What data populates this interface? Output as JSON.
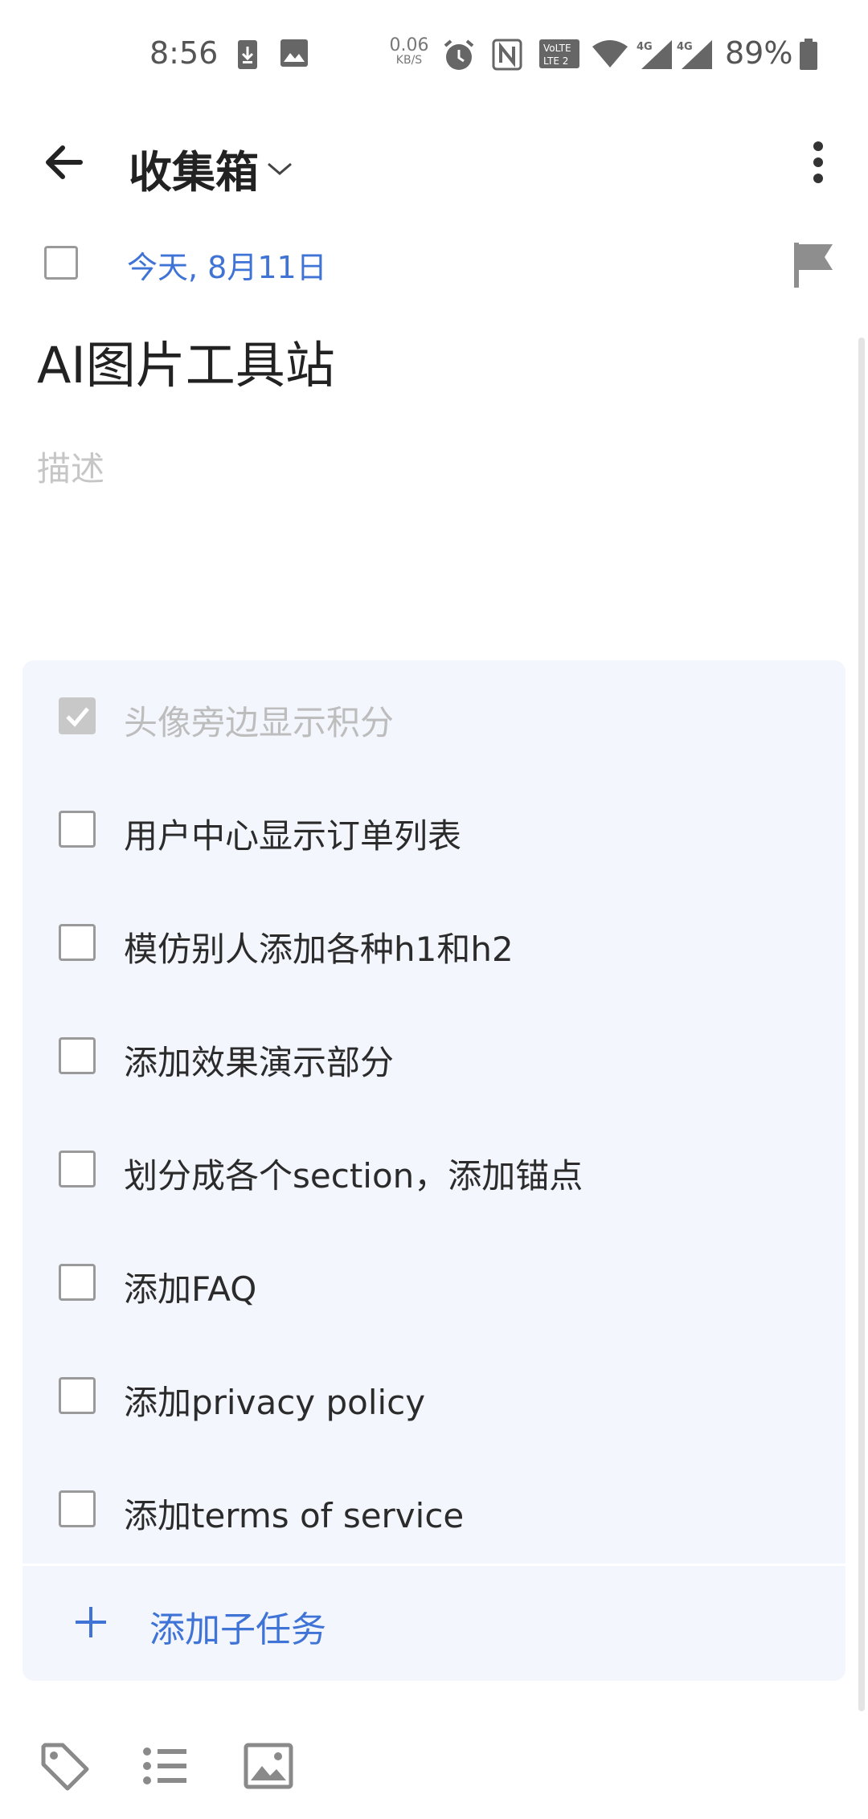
{
  "status_bar": {
    "time": "8:56",
    "net_speed_value": "0.06",
    "net_speed_unit": "KB/S",
    "battery": "89%",
    "icons": [
      "download-icon",
      "image-icon",
      "alarm-icon",
      "nfc-icon",
      "volte-icon",
      "wifi-icon",
      "signal-4g-icon",
      "signal-4g-icon",
      "battery-icon"
    ]
  },
  "header": {
    "title": "收集箱",
    "back_icon": "arrow-left-icon",
    "more_icon": "more-vertical-icon"
  },
  "task": {
    "date": "今天, 8月11日",
    "title": "AI图片工具站",
    "description_placeholder": "描述"
  },
  "subtasks": [
    {
      "label": "头像旁边显示积分",
      "done": true
    },
    {
      "label": "用户中心显示订单列表",
      "done": false
    },
    {
      "label": "模仿别人添加各种h1和h2",
      "done": false
    },
    {
      "label": "添加效果演示部分",
      "done": false
    },
    {
      "label": "划分成各个section，添加锚点",
      "done": false
    },
    {
      "label": "添加FAQ",
      "done": false
    },
    {
      "label": "添加privacy policy",
      "done": false
    },
    {
      "label": "添加terms of service",
      "done": false
    }
  ],
  "add_subtask_label": "添加子任务",
  "toolbar": {
    "icons": [
      "tag-icon",
      "checklist-icon",
      "image-icon"
    ]
  },
  "colors": {
    "accent": "#3f73d6",
    "panel_bg": "#f3f6fd",
    "placeholder": "#c6c6c6"
  }
}
